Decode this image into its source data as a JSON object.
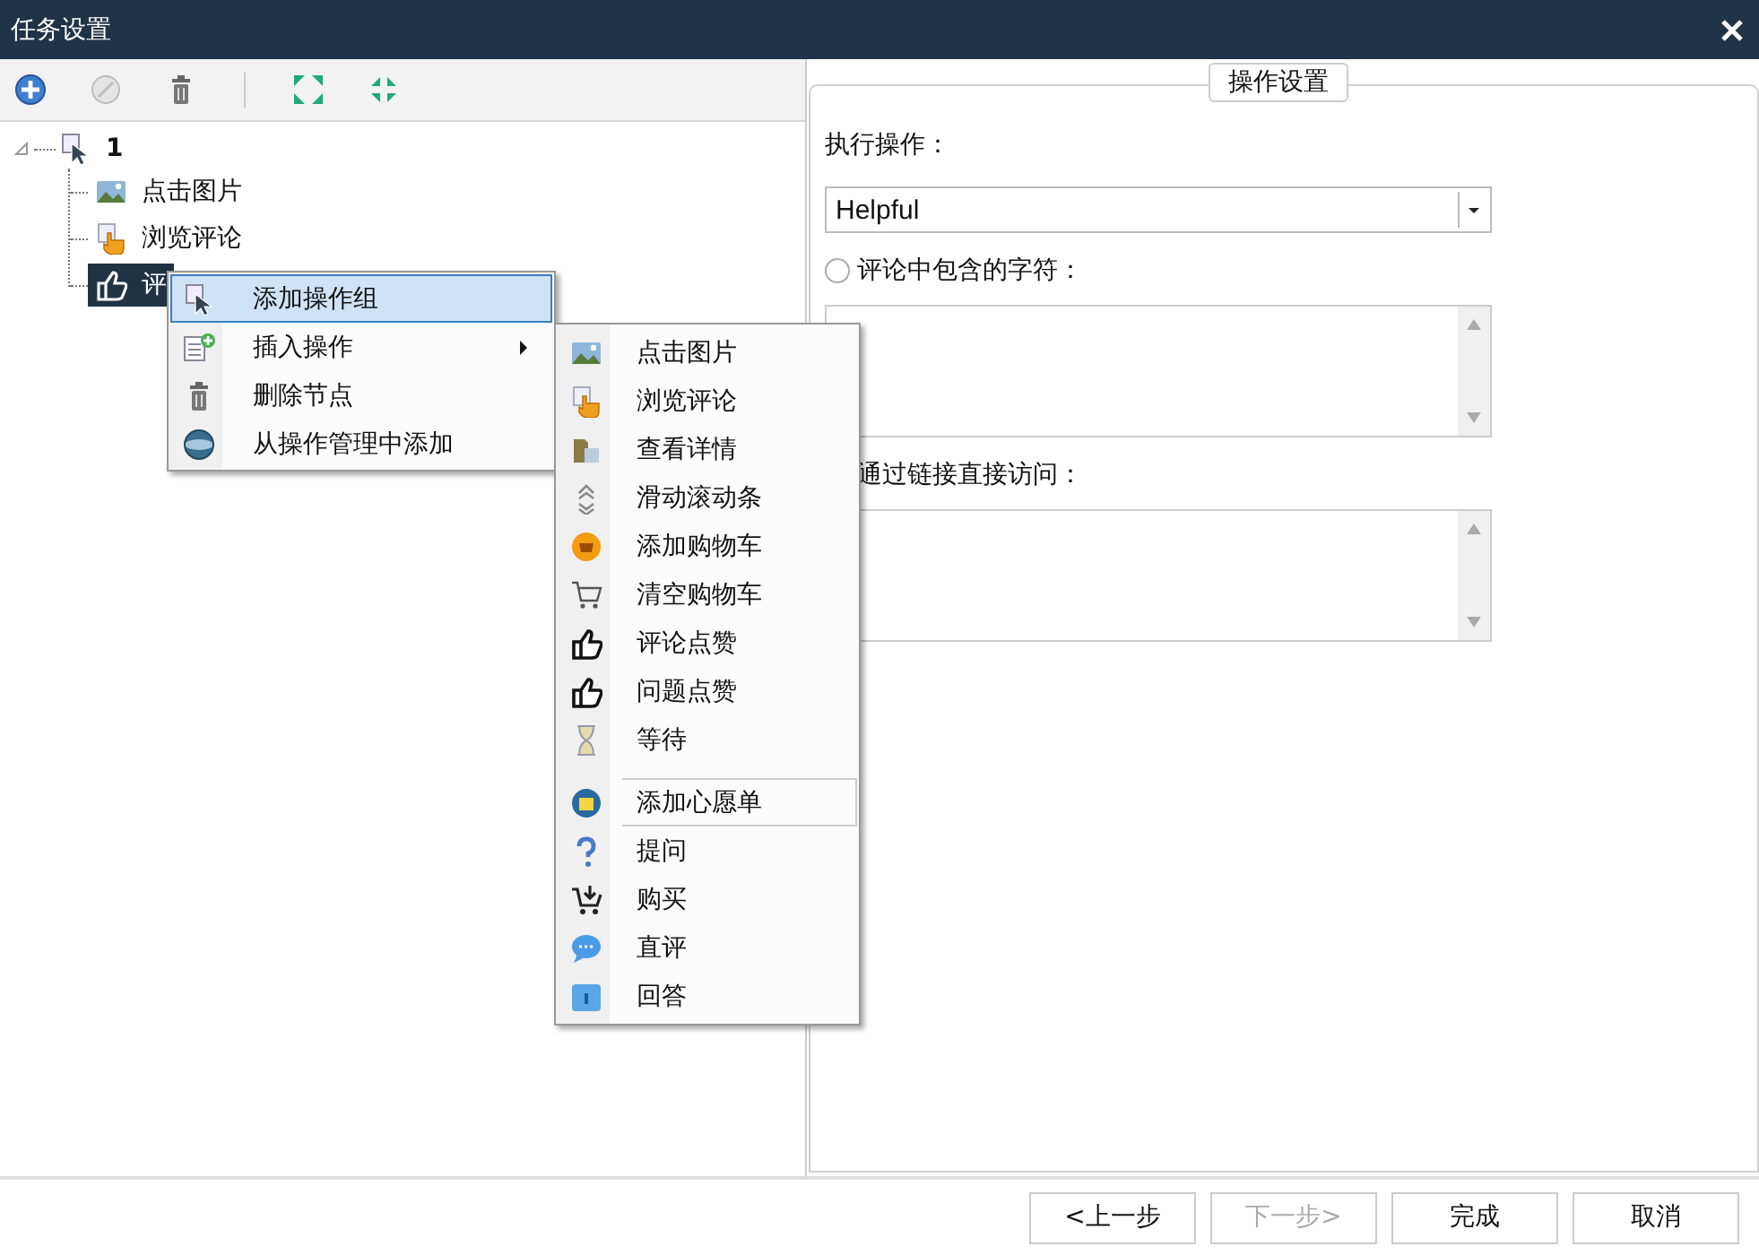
{
  "window": {
    "title": "任务设置"
  },
  "toolbar": [
    {
      "disabled": false
    },
    {
      "disabled": true
    },
    {
      "disabled": false
    },
    {
      "disabled": false
    },
    {
      "disabled": false
    }
  ],
  "tree": {
    "label": "1",
    "expanded": true,
    "children": [
      {
        "label": "点击图片",
        "selected": false
      },
      {
        "label": "浏览评论",
        "selected": false
      },
      {
        "label": "评",
        "selected": true
      }
    ]
  },
  "context_menu": {
    "items": [
      {
        "label": "添加操作组",
        "highlighted": true,
        "submenu": false
      },
      {
        "label": "插入操作",
        "highlighted": false,
        "submenu": true
      },
      {
        "label": "删除节点",
        "highlighted": false,
        "submenu": false
      },
      {
        "label": "从操作管理中添加",
        "highlighted": false,
        "submenu": false
      }
    ]
  },
  "submenu": {
    "items": [
      {
        "label": "点击图片",
        "separator_before": false
      },
      {
        "label": "浏览评论",
        "separator_before": false
      },
      {
        "label": "查看详情",
        "separator_before": false
      },
      {
        "label": "滑动滚动条",
        "separator_before": false
      },
      {
        "label": "添加购物车",
        "separator_before": false
      },
      {
        "label": "清空购物车",
        "separator_before": false
      },
      {
        "label": "评论点赞",
        "separator_before": false
      },
      {
        "label": "问题点赞",
        "separator_before": false
      },
      {
        "label": "等待",
        "separator_before": false
      },
      {
        "label": "添加心愿单",
        "separator_before": true
      },
      {
        "label": "提问",
        "separator_before": false
      },
      {
        "label": "购买",
        "separator_before": false
      },
      {
        "label": "直评",
        "separator_before": false
      },
      {
        "label": "回答",
        "separator_before": false
      }
    ]
  },
  "settings": {
    "legend": "操作设置",
    "action_label": "执行操作：",
    "action_value": "Helpful",
    "contains": {
      "label": "评论中包含的字符：",
      "selected": false
    },
    "direct": {
      "label": "通过链接直接访问："
    }
  },
  "buttons": [
    {
      "label": "<上一步",
      "disabled": false
    },
    {
      "label": "下一步>",
      "disabled": true
    },
    {
      "label": "完成",
      "disabled": false
    },
    {
      "label": "取消",
      "disabled": false
    }
  ]
}
